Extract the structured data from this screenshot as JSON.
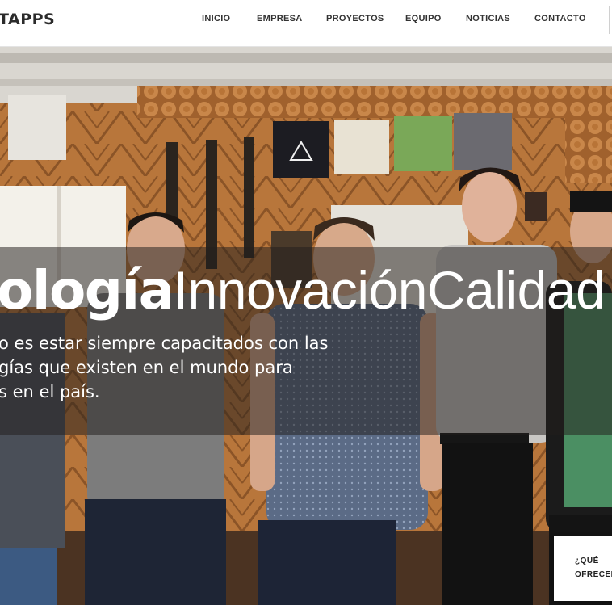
{
  "header": {
    "logo": "TAPPS",
    "nav": [
      "INICIO",
      "EMPRESA",
      "PROYECTOS",
      "EQUIPO",
      "NOTICIAS",
      "CONTACTO"
    ]
  },
  "hero": {
    "headline_bold": "ología",
    "headline_thin": "InnovaciónCalidad",
    "subtext_lines": [
      "o es estar siempre capacitados con las",
      "gías que existen en el mundo para",
      "s en el país."
    ],
    "photo_description_icon": "team-photo",
    "overlay_color": "#231e1c"
  },
  "offer_card": {
    "line1": "¿QUÉ",
    "line2": "OFRECEM"
  },
  "colors": {
    "header_bg": "#ffffff",
    "nav_text": "#333333",
    "headline_text": "#ffffff"
  }
}
